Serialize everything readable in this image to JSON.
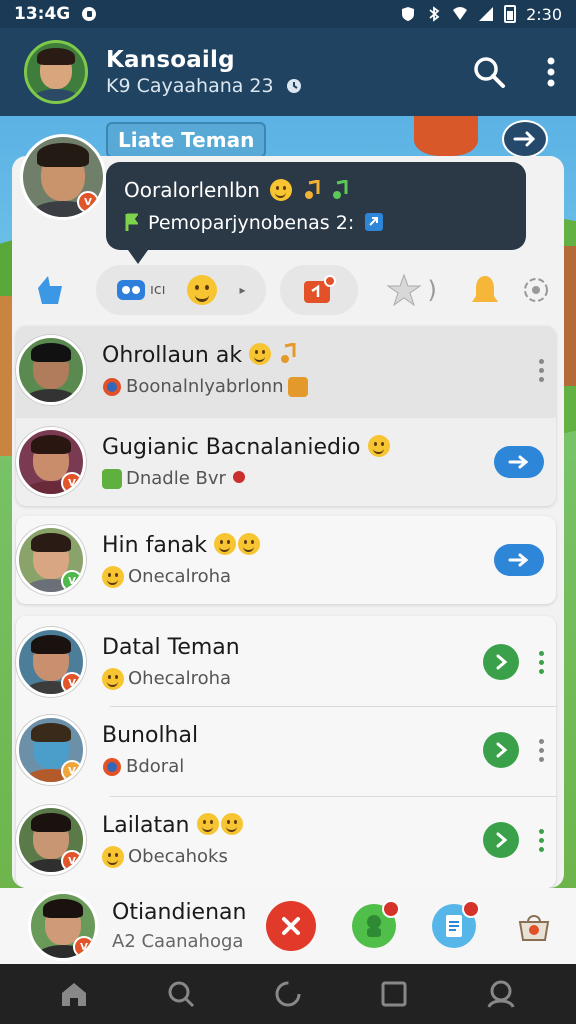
{
  "status_bar": {
    "time": "13:4G"
  },
  "header": {
    "title": "Kansoailg",
    "subtitle": "K9 Cayaahana 23"
  },
  "banner": {
    "label": "Liate Teman"
  },
  "bubble": {
    "line1": "Ooralorlenlbn",
    "line2": "Pemoparjynobenas 2:"
  },
  "reactions": {
    "count_label": "ıcı"
  },
  "friends": [
    {
      "name": "Ohrollaun ak",
      "status": "Boonalnlyabrlonn",
      "action": "kebab"
    },
    {
      "name": "Gugianic Bacnalaniedio",
      "status": "Dnadle Bvr",
      "action": "send"
    },
    {
      "name": "Hin fanak",
      "status": "Onecalroha",
      "action": "send"
    },
    {
      "name": "Datal Teman",
      "status": "Ohecalroha",
      "action": "go"
    },
    {
      "name": "Bunolhal",
      "status": "Bdoral",
      "action": "go"
    },
    {
      "name": "Lailatan",
      "status": "Obecahoks",
      "action": "go"
    }
  ],
  "bottom_bar": {
    "name": "Otiandienan",
    "subtitle": "A2 Caanahoga"
  },
  "colors": {
    "header_bg": "#1f4360",
    "send_blue": "#2d86d8",
    "go_green": "#3aa14a",
    "decline_red": "#e23a2a"
  }
}
